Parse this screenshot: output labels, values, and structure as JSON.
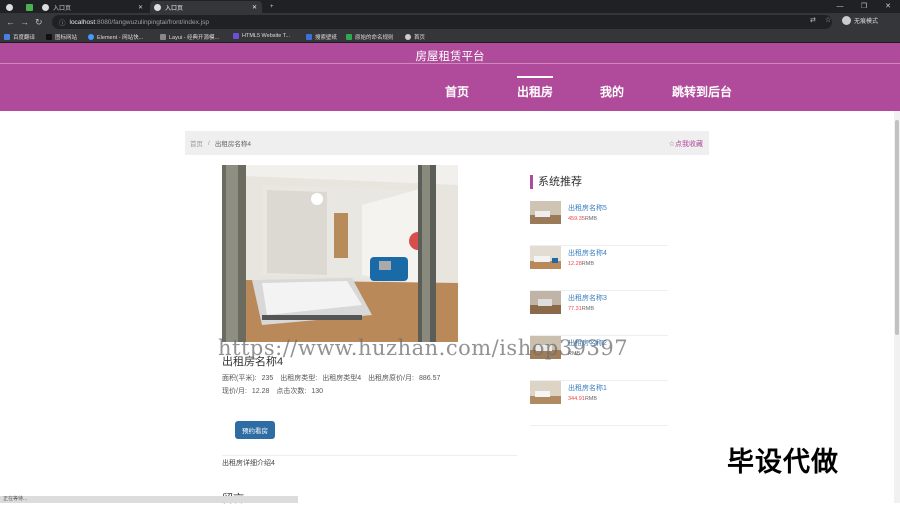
{
  "browser": {
    "tabs": [
      {
        "label": ""
      },
      {
        "label": ""
      },
      {
        "label": "入口页"
      },
      {
        "label": "入口页"
      }
    ],
    "new_tab": "+",
    "window_controls": [
      "—",
      "❐",
      "✕"
    ],
    "url_host": "localhost",
    "url_path": ":8080/fangwuzulinpingtai/front/index.jsp",
    "profile": "无痕模式",
    "bookmarks": [
      {
        "label": "百度翻译",
        "color": "#4a7fdf"
      },
      {
        "label": "图标网站",
        "color": "#222222"
      },
      {
        "label": "Element - 网站快...",
        "color": "#409eff"
      },
      {
        "label": "Layui - 经典开源模...",
        "color": "#888888"
      },
      {
        "label": "HTML5 Website T...",
        "color": "#6c4fd8"
      },
      {
        "label": "搜索壁纸",
        "color": "#3b72d9"
      },
      {
        "label": "原始的命名规则",
        "color": "#2fa84f"
      },
      {
        "label": "首页",
        "color": "#cccccc"
      }
    ]
  },
  "site": {
    "title": "房屋租赁平台",
    "nav": [
      "首页",
      "出租房",
      "我的",
      "跳转到后台"
    ],
    "active_nav": "出租房",
    "brand_color": "#b04a9b"
  },
  "breadcrumb": {
    "home": "首页",
    "separator": "/",
    "current": "出租房名称4",
    "favorite": "☆点我收藏"
  },
  "detail": {
    "name": "出租房名称4",
    "props_line1": [
      {
        "label": "面积(平米):",
        "value": "235"
      },
      {
        "label": "出租房类型:",
        "value": "出租房类型4"
      },
      {
        "label": "出租房原价/月:",
        "value": "886.57"
      }
    ],
    "props_line2": [
      {
        "label": "现价/月:",
        "value": "12.28"
      },
      {
        "label": "点击次数:",
        "value": "130"
      }
    ],
    "book_button": "预约看房",
    "description": "出租房详细介绍4",
    "message_title": "留言"
  },
  "recommend": {
    "title": "系统推荐",
    "unit": "RMB",
    "items": [
      {
        "name": "出租房名称5",
        "price": "459.35"
      },
      {
        "name": "出租房名称4",
        "price": "12.28"
      },
      {
        "name": "出租房名称3",
        "price": "77.31"
      },
      {
        "name": "出租房名称2",
        "price": ""
      },
      {
        "name": "出租房名称1",
        "price": "344.91"
      }
    ]
  },
  "watermark": "https://www.huzhan.com/ishop39397",
  "overlay_text": "毕设代做",
  "status_text": "正在等待..."
}
